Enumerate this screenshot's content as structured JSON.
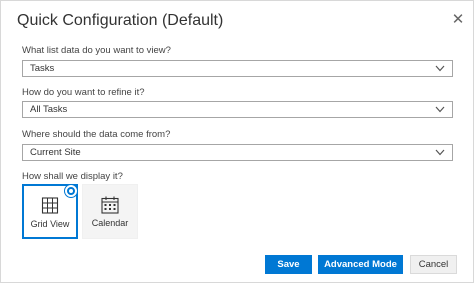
{
  "dialog": {
    "title": "Quick Configuration (Default)",
    "close_icon": "close-icon"
  },
  "fields": [
    {
      "question": "What list data do you want to view?",
      "value": "Tasks"
    },
    {
      "question": "How do you want to refine it?",
      "value": "All Tasks"
    },
    {
      "question": "Where should the data come from?",
      "value": "Current Site"
    }
  ],
  "display": {
    "question": "How shall we display it?",
    "options": [
      {
        "label": "Grid View",
        "icon": "grid-icon",
        "selected": true
      },
      {
        "label": "Calendar",
        "icon": "calendar-icon",
        "selected": false
      }
    ]
  },
  "buttons": {
    "save": "Save",
    "advanced": "Advanced Mode",
    "cancel": "Cancel"
  },
  "colors": {
    "accent": "#0078d4"
  }
}
